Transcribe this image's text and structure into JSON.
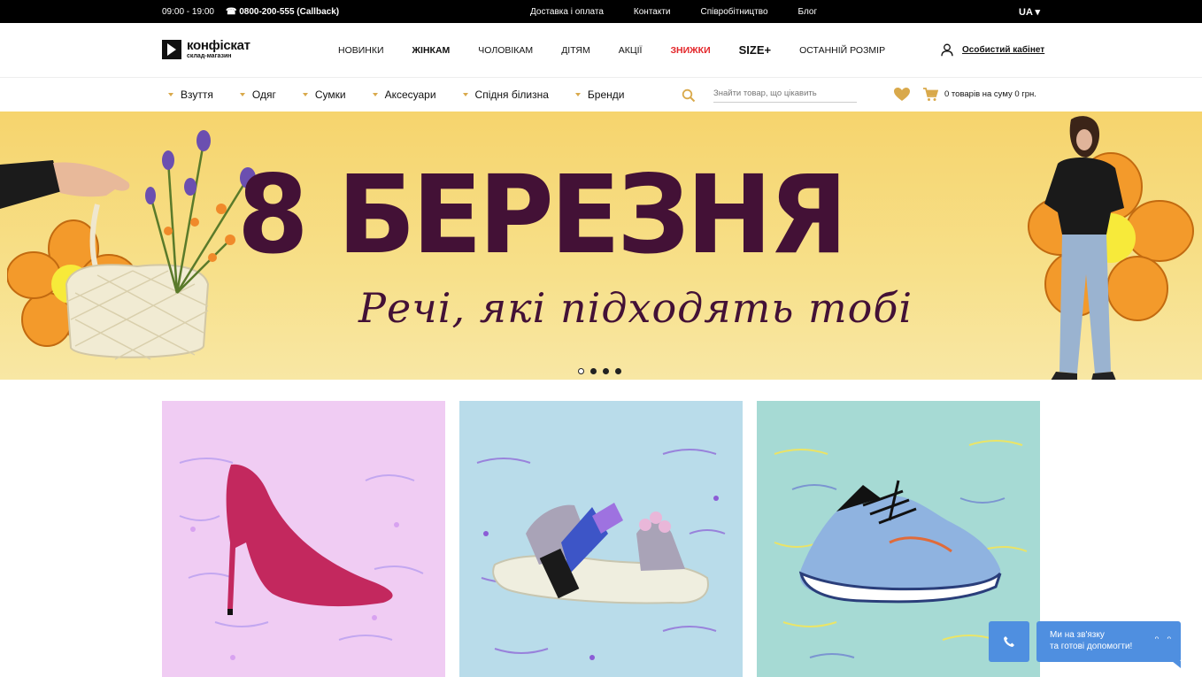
{
  "topbar": {
    "hours": "09:00 - 19:00",
    "phone": "☎ 0800-200-555 (Callback)",
    "links": [
      "Доставка і оплата",
      "Контакти",
      "Співробітництво",
      "Блог"
    ],
    "lang": "UA ▾"
  },
  "header": {
    "logo_name": "конфіскат",
    "logo_tag": "склад-магазин",
    "nav": [
      "Новинки",
      "Жінкам",
      "Чоловікам",
      "Дітям",
      "Акції",
      "Знижки",
      "SIZE+",
      "Останній розмір"
    ],
    "account": "Особистий кабінет"
  },
  "catbar": {
    "categories": [
      "Взуття",
      "Одяг",
      "Сумки",
      "Аксесуари",
      "Спідня білизна",
      "Бренди"
    ],
    "search_placeholder": "Знайти товар, що цікавить",
    "cart": "0 товарів на суму 0 грн."
  },
  "banner": {
    "headline": "8 БЕРЕЗНЯ",
    "subline": "Речі, які підходять тобі",
    "slides": 4,
    "active_slide": 1
  },
  "chat": {
    "text_line1": "Ми на зв'язку",
    "text_line2": "та готові допомогти!"
  },
  "colors": {
    "accent_red": "#e3262a",
    "banner_text": "#431136",
    "banner_bg": "#f6d46d",
    "chat_blue": "#4f8fe0",
    "gold": "#d9a94b"
  }
}
